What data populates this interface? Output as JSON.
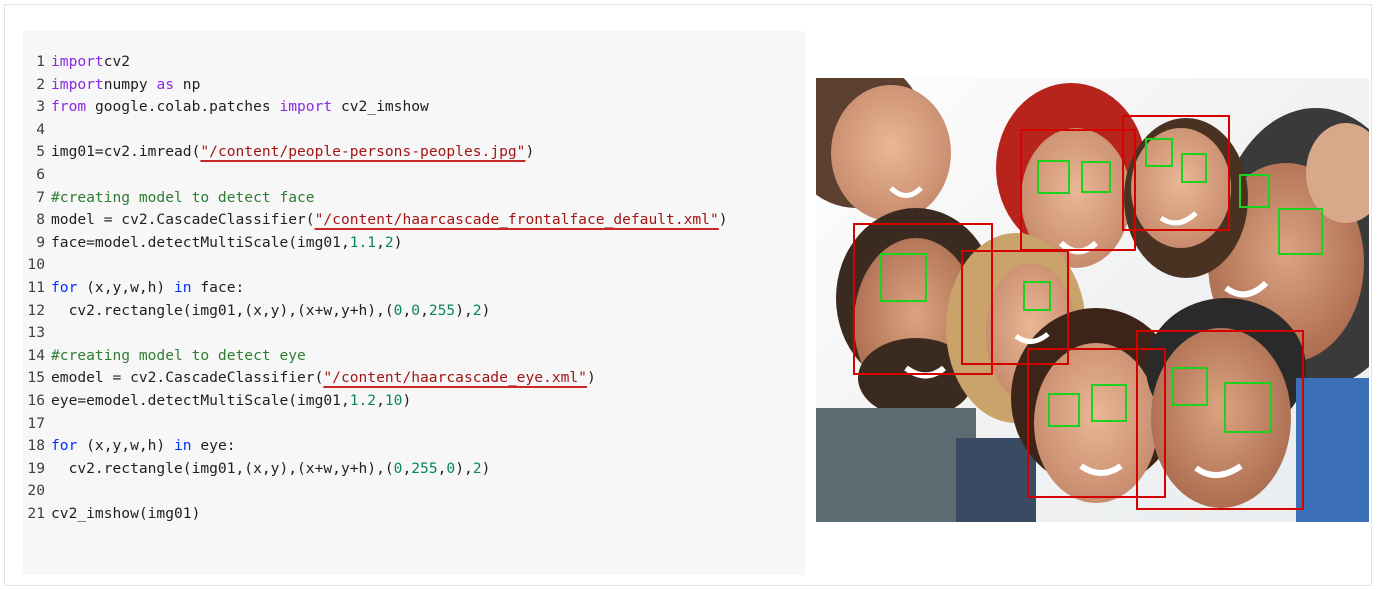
{
  "code": {
    "lines": [
      {
        "n": "1",
        "parts": [
          [
            "k-import",
            "import"
          ],
          [
            "",
            "cv2"
          ]
        ]
      },
      {
        "n": "2",
        "parts": [
          [
            "k-import",
            "import"
          ],
          [
            "",
            "numpy "
          ],
          [
            "k-import",
            "as"
          ],
          [
            "",
            " np"
          ]
        ]
      },
      {
        "n": "3",
        "parts": [
          [
            "k-import",
            "from"
          ],
          [
            "",
            " google.colab.patches "
          ],
          [
            "k-import",
            "import"
          ],
          [
            "",
            " cv2_imshow"
          ]
        ]
      },
      {
        "n": "4",
        "parts": []
      },
      {
        "n": "5",
        "parts": [
          [
            "",
            "img01=cv2.imread("
          ],
          [
            "k-str",
            "\"/content/people-persons-peoples.jpg\""
          ],
          [
            "",
            ")"
          ]
        ]
      },
      {
        "n": "6",
        "parts": []
      },
      {
        "n": "7",
        "parts": [
          [
            "k-cmt",
            "#creating model to detect face"
          ]
        ]
      },
      {
        "n": "8",
        "parts": [
          [
            "",
            "model = cv2.CascadeClassifier("
          ],
          [
            "k-str",
            "\"/content/haarcascade_frontalface_default.xml\""
          ],
          [
            "",
            ")"
          ]
        ]
      },
      {
        "n": "9",
        "parts": [
          [
            "",
            "face=model.detectMultiScale(img01,"
          ],
          [
            "k-num",
            "1.1"
          ],
          [
            "",
            ","
          ],
          [
            "k-num",
            "2"
          ],
          [
            "",
            ")"
          ]
        ]
      },
      {
        "n": "10",
        "parts": []
      },
      {
        "n": "11",
        "parts": [
          [
            "k-blue",
            "for"
          ],
          [
            "",
            " (x,y,w,h) "
          ],
          [
            "k-blue",
            "in"
          ],
          [
            "",
            " face:"
          ]
        ]
      },
      {
        "n": "12",
        "parts": [
          [
            "",
            "  cv2.rectangle(img01,(x,y),(x+w,y+h),("
          ],
          [
            "k-num",
            "0"
          ],
          [
            "",
            ","
          ],
          [
            "k-num",
            "0"
          ],
          [
            "",
            ","
          ],
          [
            "k-num",
            "255"
          ],
          [
            "",
            "),"
          ],
          [
            "k-num",
            "2"
          ],
          [
            "",
            ")"
          ]
        ]
      },
      {
        "n": "13",
        "parts": []
      },
      {
        "n": "14",
        "parts": [
          [
            "k-cmt",
            "#creating model to detect eye"
          ]
        ]
      },
      {
        "n": "15",
        "parts": [
          [
            "",
            "emodel = cv2.CascadeClassifier("
          ],
          [
            "k-str",
            "\"/content/haarcascade_eye.xml\""
          ],
          [
            "",
            ")"
          ]
        ]
      },
      {
        "n": "16",
        "parts": [
          [
            "",
            "eye=emodel.detectMultiScale(img01,"
          ],
          [
            "k-num",
            "1.2"
          ],
          [
            "",
            ","
          ],
          [
            "k-num",
            "10"
          ],
          [
            "",
            ")"
          ]
        ]
      },
      {
        "n": "17",
        "parts": []
      },
      {
        "n": "18",
        "parts": [
          [
            "k-blue",
            "for"
          ],
          [
            "",
            " (x,y,w,h) "
          ],
          [
            "k-blue",
            "in"
          ],
          [
            "",
            " eye:"
          ]
        ]
      },
      {
        "n": "19",
        "parts": [
          [
            "",
            "  cv2.rectangle(img01,(x,y),(x+w,y+h),("
          ],
          [
            "k-num",
            "0"
          ],
          [
            "",
            ","
          ],
          [
            "k-num",
            "255"
          ],
          [
            "",
            ","
          ],
          [
            "k-num",
            "0"
          ],
          [
            "",
            "),"
          ],
          [
            "k-num",
            "2"
          ],
          [
            "",
            ")"
          ]
        ]
      },
      {
        "n": "20",
        "parts": []
      },
      {
        "n": "21",
        "parts": [
          [
            "",
            "cv2_imshow(img01)"
          ]
        ]
      }
    ]
  },
  "output_image": {
    "face_box_color": "#d50000",
    "eye_box_color": "#1fd11f"
  }
}
